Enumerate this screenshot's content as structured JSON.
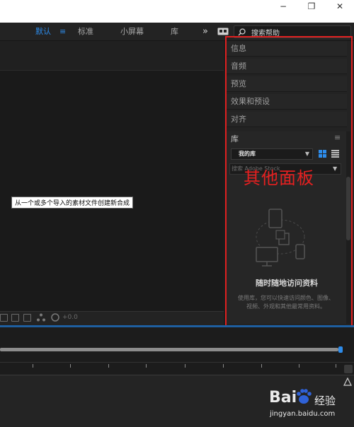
{
  "window": {
    "minimize_glyph": "−",
    "restore_glyph": "❐",
    "close_glyph": "✕"
  },
  "workspace_bar": {
    "tabs": [
      {
        "label": "默认",
        "active": true
      },
      {
        "label": "标准",
        "active": false
      },
      {
        "label": "小屏幕",
        "active": false
      },
      {
        "label": "库",
        "active": false
      }
    ],
    "menu_glyph": "≡",
    "overflow_glyph": "»",
    "search_label": "搜索帮助"
  },
  "composition": {
    "tooltip": "从一个或多个导入的素材文件创建新合成",
    "exposure_value": "+0.0"
  },
  "right_panel": {
    "items": [
      "信息",
      "音频",
      "预览",
      "效果和预设",
      "对齐"
    ],
    "library": {
      "title": "库",
      "menu_glyph": "≡",
      "selected_library": "我的库",
      "search_placeholder": "搜索 Adobe Stock",
      "headline": "随时随地访问资料",
      "description": "使用库，您可以快速访问颜色、图像、视频、外观和其他最常用资料。"
    }
  },
  "annotation": {
    "label": "其他面板",
    "color": "#e02020"
  },
  "watermark": {
    "logo": "Bai",
    "logo_tail": "du",
    "cn": "经验",
    "url": "jingyan.baidu.com"
  },
  "colors": {
    "accent": "#2d8ceb"
  }
}
